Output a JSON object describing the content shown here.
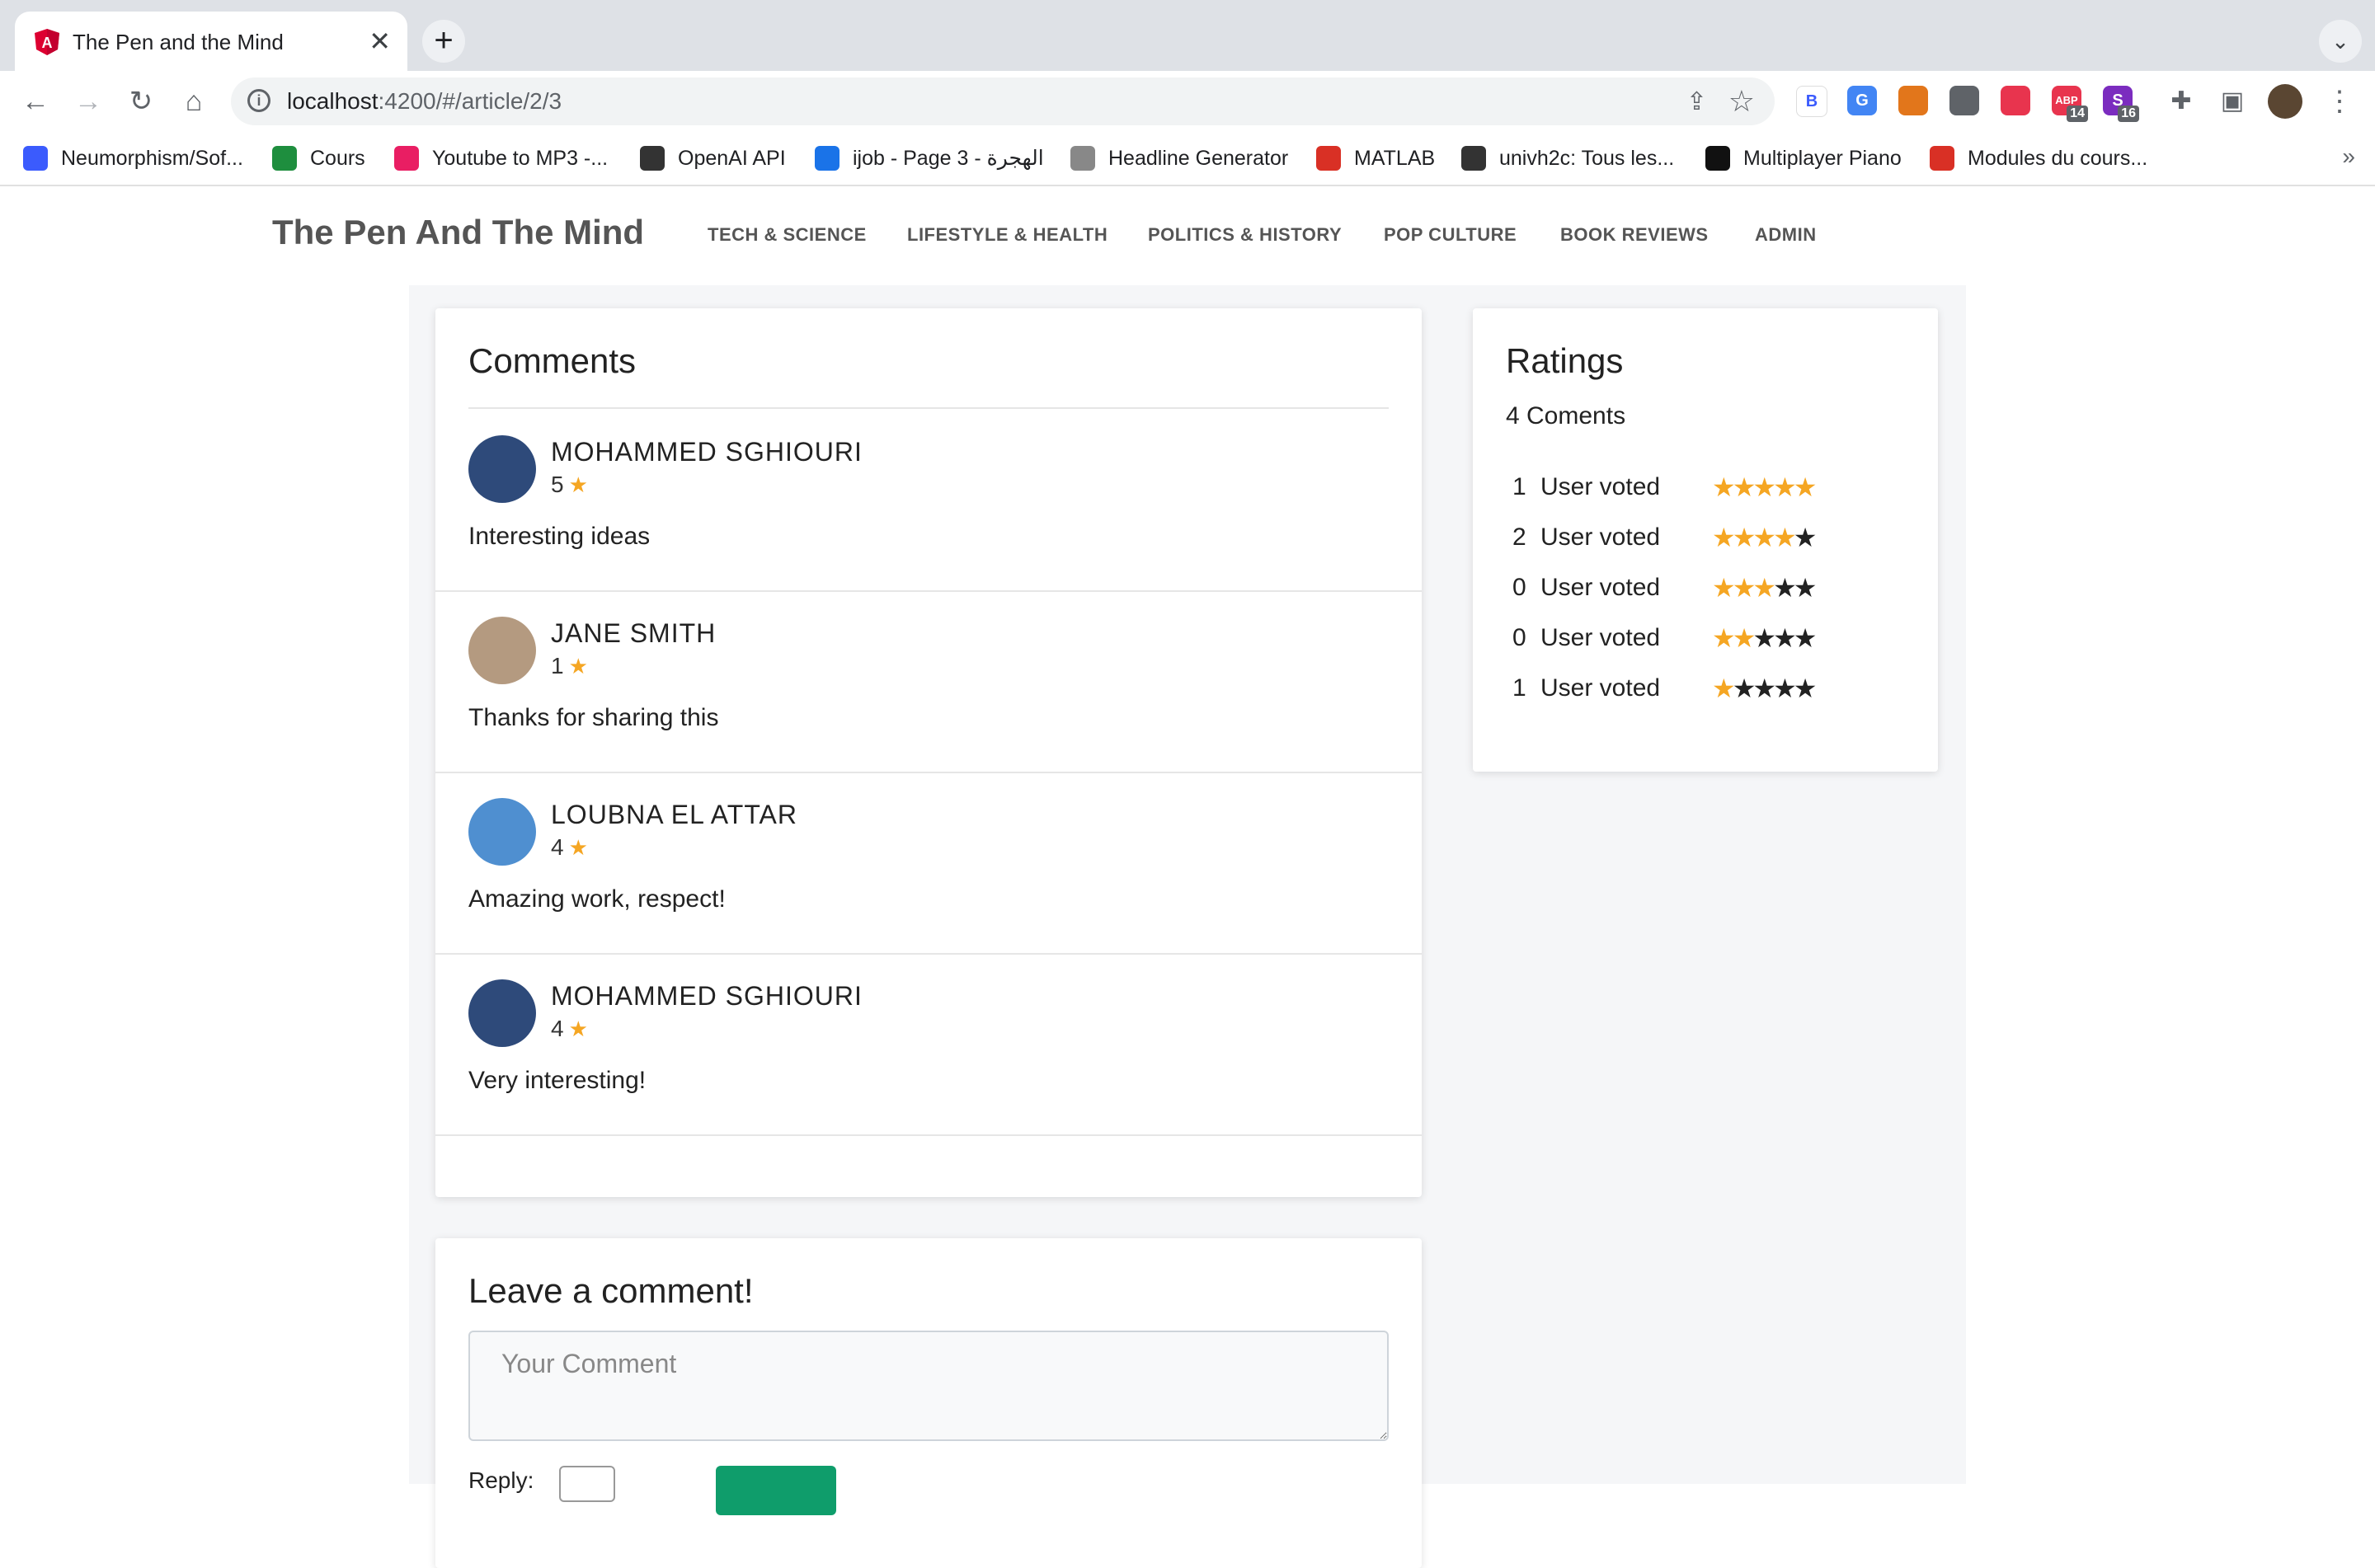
{
  "browser": {
    "tab_title": "The Pen and the Mind",
    "url_host": "localhost",
    "url_rest": ":4200/#/article/2/3",
    "extensions": [
      {
        "name": "b-extension",
        "label": "B",
        "color": "#ffffff"
      },
      {
        "name": "translate-extension",
        "label": "G",
        "color": "#4285f4"
      },
      {
        "name": "metamask-extension",
        "label": "",
        "color": "#e2761b"
      },
      {
        "name": "code-extension",
        "label": "",
        "color": "#5f6368"
      },
      {
        "name": "red-extension",
        "label": "",
        "color": "#e8344e"
      },
      {
        "name": "abp-extension",
        "label": "ABP",
        "color": "#e8344e",
        "badge": "14"
      },
      {
        "name": "s-extension",
        "label": "S",
        "color": "#7b2cbf",
        "badge": "16"
      }
    ]
  },
  "bookmarks": [
    {
      "label": "Neumorphism/Sof...",
      "icon": "blue-square-icon",
      "color": "#3b5bfd"
    },
    {
      "label": "Cours",
      "icon": "classroom-icon",
      "color": "#1e8e3e"
    },
    {
      "label": "Youtube to MP3 -...",
      "icon": "download-icon",
      "color": "#e91e63"
    },
    {
      "label": "OpenAI API",
      "icon": "openai-icon",
      "color": "#333333"
    },
    {
      "label": "ijob - Page 3 - الهجرة",
      "icon": "ijob-icon",
      "color": "#1a73e8"
    },
    {
      "label": "Headline Generator",
      "icon": "bulb-icon",
      "color": "#888888"
    },
    {
      "label": "MATLAB",
      "icon": "gauge-icon",
      "color": "#d93025"
    },
    {
      "label": "univh2c: Tous les...",
      "icon": "globe-icon",
      "color": "#333333"
    },
    {
      "label": "Multiplayer Piano",
      "icon": "piano-icon",
      "color": "#111111"
    },
    {
      "label": "Modules du cours...",
      "icon": "gear-icon",
      "color": "#d93025"
    }
  ],
  "site": {
    "brand": "The Pen And The Mind",
    "nav": [
      "TECH & SCIENCE",
      "LIFESTYLE & HEALTH",
      "POLITICS & HISTORY",
      "POP CULTURE",
      "BOOK REVIEWS",
      "ADMIN"
    ]
  },
  "comments_section": {
    "title": "Comments",
    "items": [
      {
        "author": "MOHAMMED SGHIOURI",
        "rating": "5",
        "text": "Interesting ideas",
        "avatar": "#2e4a7a"
      },
      {
        "author": "JANE SMITH",
        "rating": "1",
        "text": "Thanks for sharing this",
        "avatar": "#b49a80"
      },
      {
        "author": "LOUBNA EL ATTAR",
        "rating": "4",
        "text": "Amazing work, respect!",
        "avatar": "#4f8fd0"
      },
      {
        "author": "MOHAMMED SGHIOURI",
        "rating": "4",
        "text": "Very interesting!",
        "avatar": "#2e4a7a"
      }
    ]
  },
  "ratings": {
    "title": "Ratings",
    "subtitle": "4 Coments",
    "rows": [
      {
        "count": "1",
        "label": "User voted",
        "stars": 5
      },
      {
        "count": "2",
        "label": "User voted",
        "stars": 4
      },
      {
        "count": "0",
        "label": "User voted",
        "stars": 3
      },
      {
        "count": "0",
        "label": "User voted",
        "stars": 2
      },
      {
        "count": "1",
        "label": "User voted",
        "stars": 1
      }
    ]
  },
  "leave_comment": {
    "title": "Leave a comment!",
    "placeholder": "Your Comment",
    "reply_label": "Reply:"
  }
}
